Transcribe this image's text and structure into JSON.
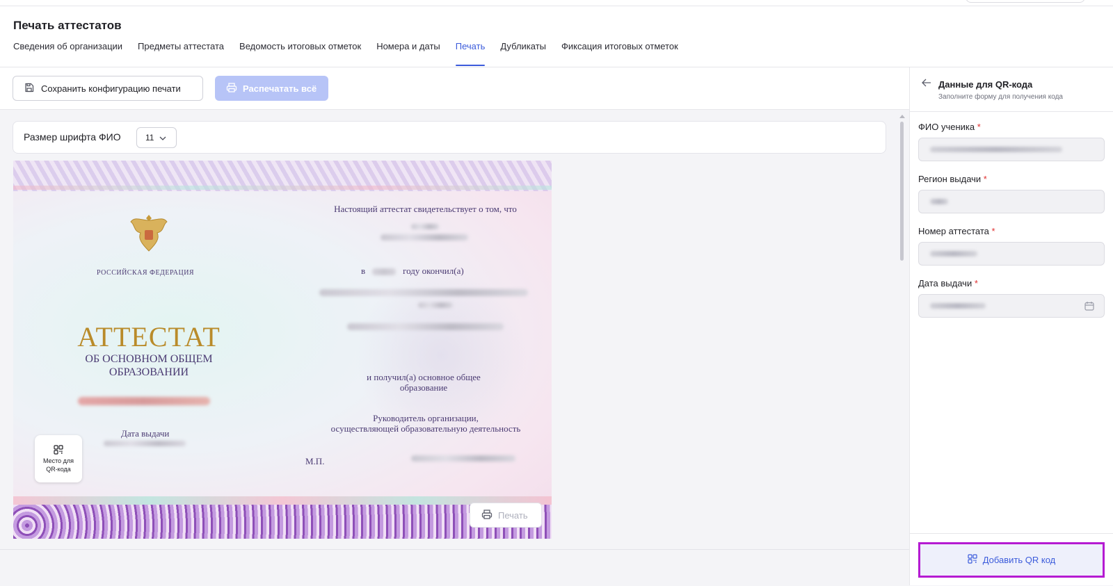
{
  "page": {
    "title": "Печать аттестатов"
  },
  "tabs": [
    {
      "label": "Сведения об организации"
    },
    {
      "label": "Предметы аттестата"
    },
    {
      "label": "Ведомость итоговых отметок"
    },
    {
      "label": "Номера и даты"
    },
    {
      "label": "Печать",
      "active": true
    },
    {
      "label": "Дубликаты"
    },
    {
      "label": "Фиксация итоговых отметок"
    }
  ],
  "toolbar": {
    "save_label": "Сохранить конфигурацию печати",
    "print_all_label": "Распечатать всё"
  },
  "fontbar": {
    "label": "Размер шрифта ФИО",
    "value": "11"
  },
  "certificate": {
    "intro": "Настоящий аттестат свидетельствует о том, что",
    "country": "РОССИЙСКАЯ ФЕДЕРАЦИЯ",
    "year_prefix": "в",
    "year_suffix": "году окончил(а)",
    "title": "АТТЕСТАТ",
    "subtitle_1": "ОБ ОСНОВНОМ ОБЩЕМ",
    "subtitle_2": "ОБРАЗОВАНИИ",
    "received_1": "и получил(а) основное общее",
    "received_2": "образование",
    "head_1": "Руководитель организации,",
    "head_2": "осуществляющей образовательную деятельность",
    "date_label": "Дата выдачи",
    "mp": "М.П.",
    "qr_place_1": "Место для",
    "qr_place_2": "QR-кода",
    "print_label": "Печать"
  },
  "panel": {
    "title": "Данные для QR-кода",
    "subtitle": "Заполните форму для получения кода",
    "fields": [
      {
        "label": "ФИО ученика",
        "required": "*"
      },
      {
        "label": "Регион выдачи",
        "required": "*"
      },
      {
        "label": "Номер аттестата",
        "required": "*"
      },
      {
        "label": "Дата выдачи",
        "required": "*"
      }
    ],
    "add_qr_label": "Добавить QR код"
  },
  "colors": {
    "accent": "#3b5bdb",
    "disabled_button": "#b7c4f7",
    "highlight_border": "#b51bd2",
    "required": "#e03131"
  },
  "icons": [
    "save-icon",
    "printer-icon",
    "chevron-down-icon",
    "qr-code-icon",
    "arrow-left-icon",
    "calendar-icon"
  ]
}
